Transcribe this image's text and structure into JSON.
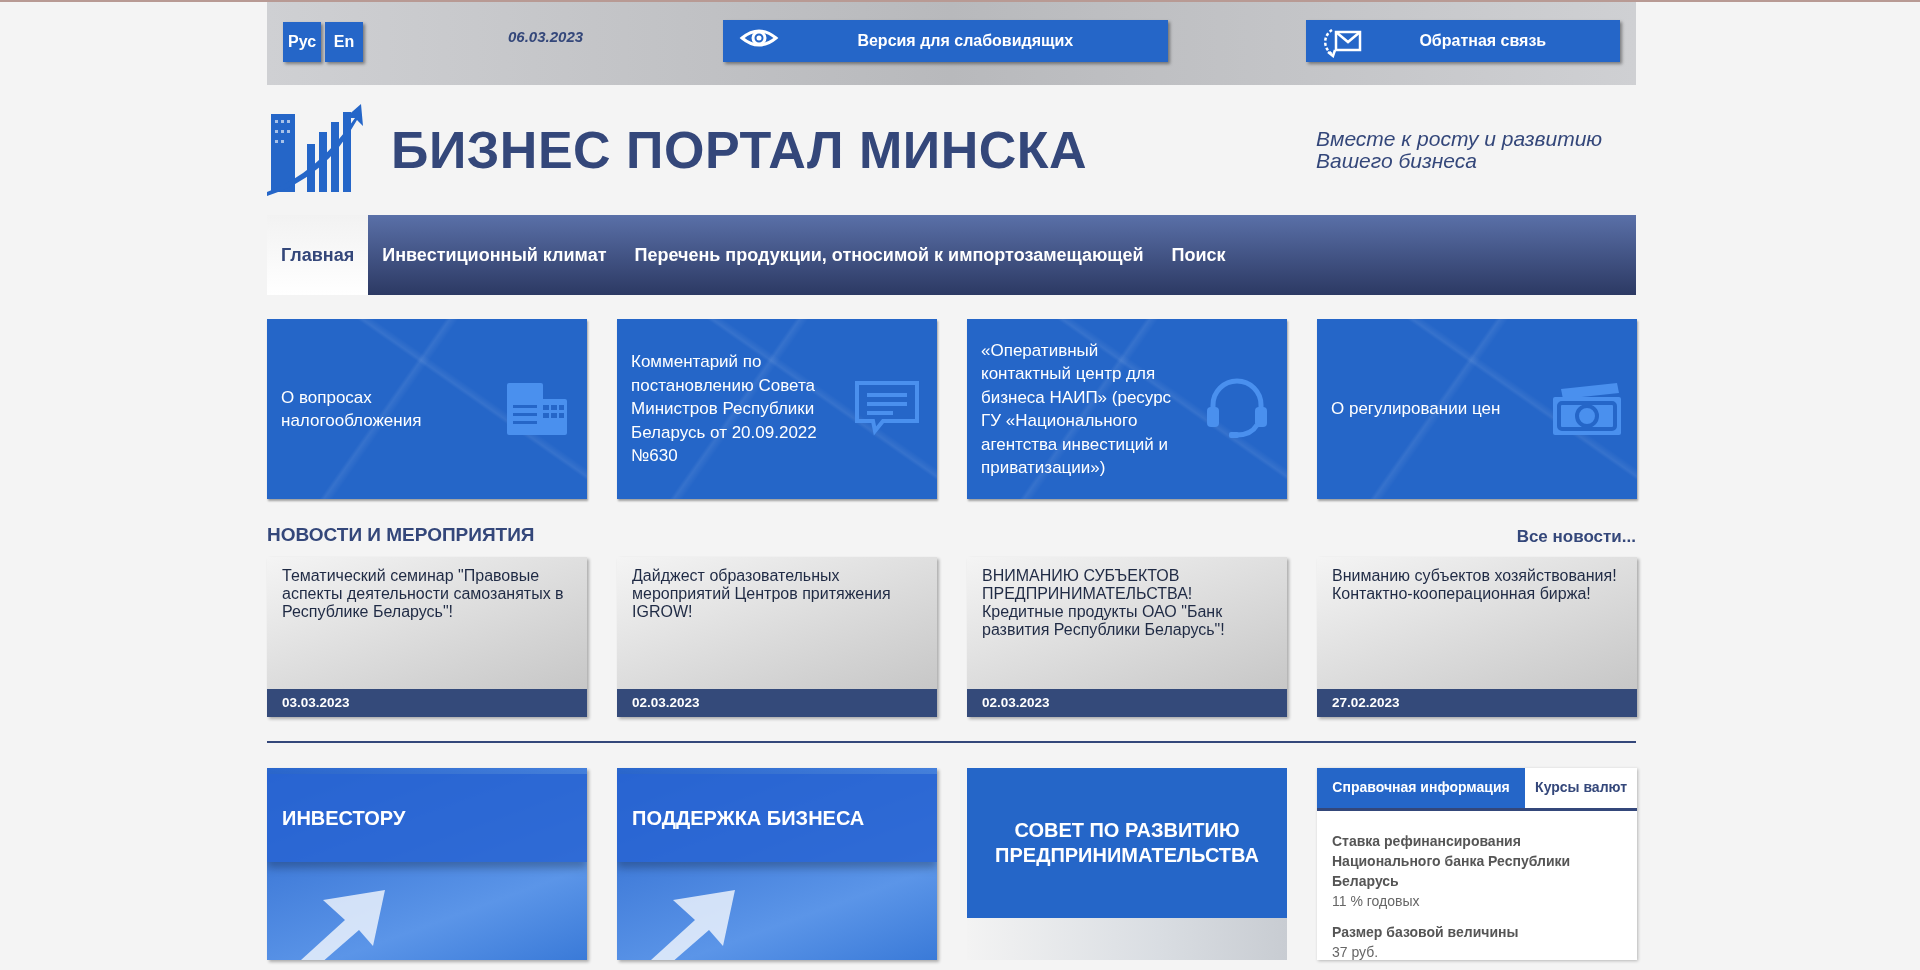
{
  "top_bar": {
    "languages": [
      {
        "label": "Рус"
      },
      {
        "label": "En"
      }
    ],
    "date": "06.03.2023",
    "buttons": [
      {
        "label": "Версия для слабовидящих"
      },
      {
        "label": "Обратная связь"
      }
    ]
  },
  "header": {
    "title": "БИЗНЕС ПОРТАЛ МИНСКА",
    "slogan": "Вместе к росту и развитию Вашего бизнеса"
  },
  "nav": {
    "items": [
      {
        "label": "Главная",
        "selected": true
      },
      {
        "label": "Инвестиционный климат",
        "selected": false
      },
      {
        "label": "Перечень продукции, относимой к импортозамещающей",
        "selected": false
      },
      {
        "label": "Поиск",
        "selected": false
      }
    ]
  },
  "tiles": [
    {
      "text": "О вопросах налогообложения"
    },
    {
      "text": "Комментарий по постановлению Совета Министров Республики Беларусь от 20.09.2022 №630"
    },
    {
      "text": "«Оперативный контактный центр для бизнеса НАИП» (ресурс ГУ «Национального агентства инвестиций и приватизации»)"
    },
    {
      "text": "О регулировании цен"
    }
  ],
  "news": {
    "title": "НОВОСТИ И МЕРОПРИЯТИЯ",
    "all_link": "Все новости...",
    "items": [
      {
        "title": "Тематический семинар \"Правовые аспекты деятельности самозанятых в Республике Беларусь\"!",
        "date": "03.03.2023"
      },
      {
        "title": "Дайджест образовательных мероприятий Центров притяжения IGROW!",
        "date": "02.03.2023"
      },
      {
        "title": "ВНИМАНИЮ СУБЪЕКТОВ ПРЕДПРИНИМАТЕЛЬСТВА! Кредитные продукты ОАО \"Банк развития Республики Беларусь\"!",
        "date": "02.03.2023"
      },
      {
        "title": "Вниманию субъектов хозяйствования! Контактно-кооперационная биржа!",
        "date": "27.02.2023"
      }
    ]
  },
  "sections": [
    {
      "title": "ИНВЕСТОРУ"
    },
    {
      "title": "ПОДДЕРЖКА БИЗНЕСА"
    }
  ],
  "council": {
    "title": "СОВЕТ ПО РАЗВИТИЮ ПРЕДПРИНИМАТЕЛЬСТВА"
  },
  "info_panel": {
    "tabs": [
      {
        "label": "Справочная информация",
        "selected": true
      },
      {
        "label": "Курсы валют",
        "selected": false
      }
    ],
    "items": [
      {
        "label": "Ставка рефинансирования Национального банка Республики Беларусь",
        "value": "11 % годовых"
      },
      {
        "label": "Размер базовой величины",
        "value": "37 руб."
      }
    ]
  }
}
